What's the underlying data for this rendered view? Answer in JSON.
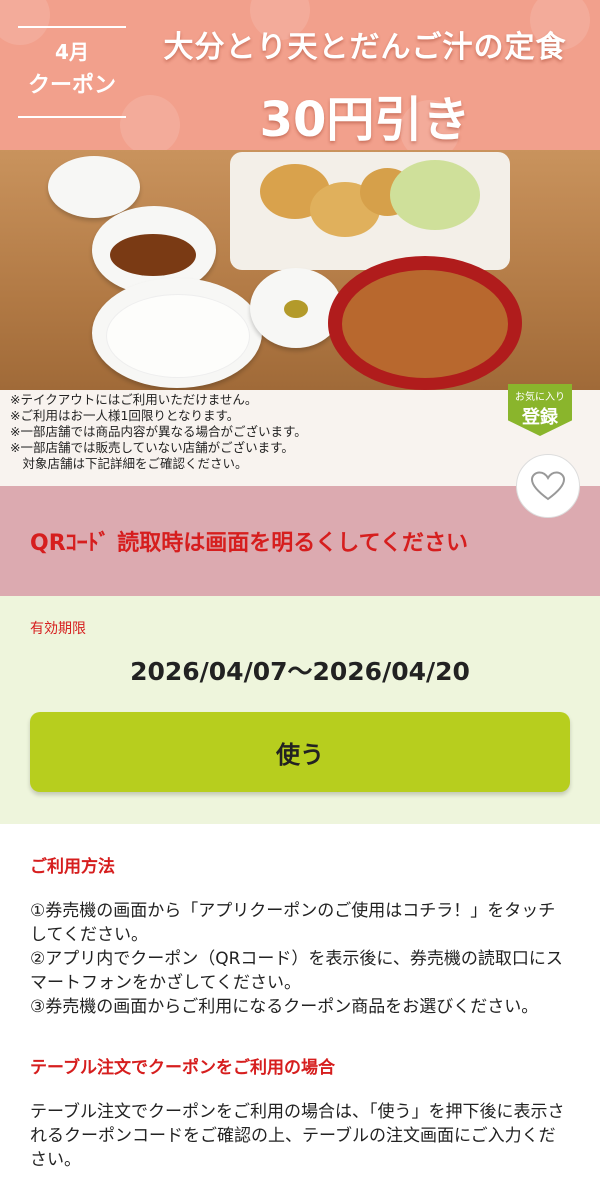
{
  "banner": {
    "month": "4月",
    "coupon": "クーポン",
    "title": "大分とり天とだんご汁の定食",
    "discount": "30円引き"
  },
  "notes": [
    "※テイクアウトにはご利用いただけません。",
    "※ご利用はお一人様1回限りとなります。",
    "※一部店舗では商品内容が異なる場合がございます。",
    "※一部店舗では販売していない店舗がございます。",
    "　対象店舗は下記詳細をご確認ください。"
  ],
  "favorite_badge": {
    "small": "お気に入り",
    "big": "登録"
  },
  "qr_notice": "QRｺｰﾄﾞ 読取時は画面を明るくしてください",
  "validity": {
    "label": "有効期限",
    "range": "2026/04/07～2026/04/20"
  },
  "use_button": "使う",
  "howto": {
    "title": "ご利用方法",
    "step1": "①券売機の画面から「アプリクーポンのご使用はコチラ！」をタッチしてください。",
    "step2": "②アプリ内でクーポン（QRコード）を表示後に、券売機の読取口にスマートフォンをかざしてください。",
    "step3": "③券売機の画面からご利用になるクーポン商品をお選びください。"
  },
  "table_order": {
    "title": "テーブル注文でクーポンをご利用の場合",
    "text": "テーブル注文でクーポンをご利用の場合は、「使う」を押下後に表示されるクーポンコードをご確認の上、テーブルの注文画面にご入力ください。"
  },
  "colors": {
    "accent_red": "#d61e1e",
    "button_green": "#b7ce1e",
    "badge_green": "#8ab52c",
    "banner_salmon": "#f2a08c",
    "notice_pink": "#dcaab0",
    "validity_bg": "#eef5dc"
  },
  "icons": {
    "heart": "heart-outline-icon"
  }
}
